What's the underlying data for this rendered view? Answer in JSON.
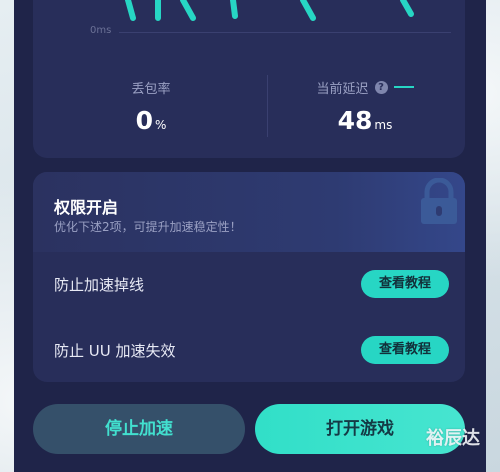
{
  "chart": {
    "zero_label": "0ms",
    "accent_color": "#27d6c4"
  },
  "stats": {
    "loss_label": "丢包率",
    "loss_value": "0",
    "loss_unit": "%",
    "latency_label": "当前延迟",
    "latency_value": "48",
    "latency_unit": "ms"
  },
  "permissions": {
    "title": "权限开启",
    "subtitle": "优化下述2项，可提升加速稳定性！",
    "items": [
      {
        "label": "防止加速掉线",
        "button": "查看教程"
      },
      {
        "label": "防止 UU 加速失效",
        "button": "查看教程"
      }
    ]
  },
  "actions": {
    "stop": "停止加速",
    "open": "打开游戏"
  },
  "watermark": "裕辰达",
  "colors": {
    "background": "#1f2449",
    "card": "#282e5a",
    "accent": "#27d6c4"
  }
}
